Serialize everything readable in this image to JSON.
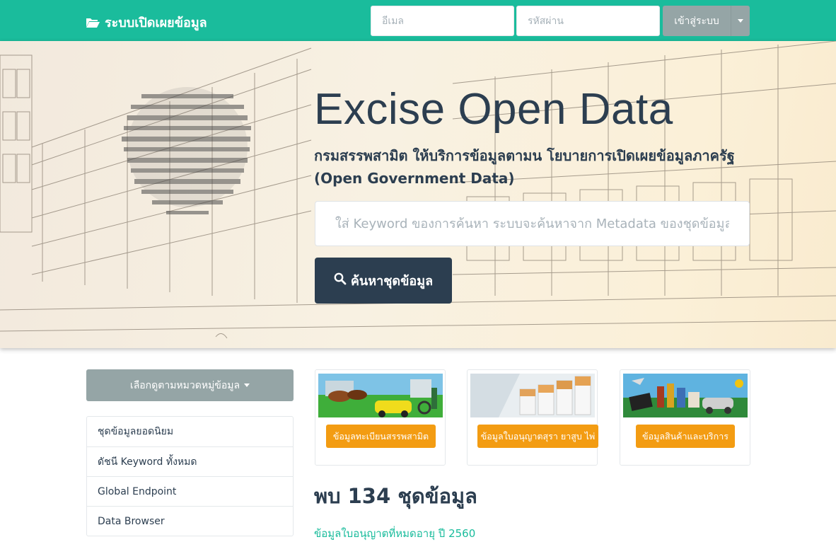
{
  "navbar": {
    "brand": "ระบบเปิดเผยข้อมูล",
    "brand_icon": "folder-open-icon",
    "email_placeholder": "อีเมล",
    "password_placeholder": "รหัสผ่าน",
    "login_label": "เข้าสู่ระบบ",
    "accent": "#1abc9c"
  },
  "hero": {
    "title": "Excise Open Data",
    "subtitle": "กรมสรรพสามิต ให้บริการข้อมูลตามน โยบายการเปิดเผยข้อมูลภาครัฐ (Open Government Data)",
    "search_placeholder": "ใส่ Keyword ของการค้นหา ระบบจะค้นหาจาก Metadata ของชุดข้อมูลทั้งหมด",
    "search_button": "ค้นหาชุดข้อมูล",
    "search_icon": "magnifier-icon",
    "watermark_text": "กรมสรรพสามิต"
  },
  "sidebar": {
    "category_button": "เลือกดูตามหมวดหมู่ข้อมูล",
    "items": [
      {
        "label": "ชุดข้อมูลยอดนิยม"
      },
      {
        "label": "ดัชนี Keyword ทั้งหมด"
      },
      {
        "label": "Global Endpoint"
      },
      {
        "label": "Data Browser"
      }
    ]
  },
  "cards": [
    {
      "label": "ข้อมูลทะเบียนสรรพสามิต",
      "image": "excise-registration-collage"
    },
    {
      "label": "ข้อมูลใบอนุญาตสุรา ยาสูบ ไพ่",
      "image": "cigarettes-closeup"
    },
    {
      "label": "ข้อมูลสินค้าและบริการ",
      "image": "goods-and-services-collage"
    }
  ],
  "results": {
    "found_text": "พบ 134 ชุดข้อมูล",
    "first_item_partial": "ข้อมูลใบอนุญาตที่หมดอายุ ปี 2560"
  },
  "colors": {
    "primary": "#2c3e50",
    "accent": "#1abc9c",
    "muted": "#95a5a6",
    "warning": "#f39c12"
  }
}
